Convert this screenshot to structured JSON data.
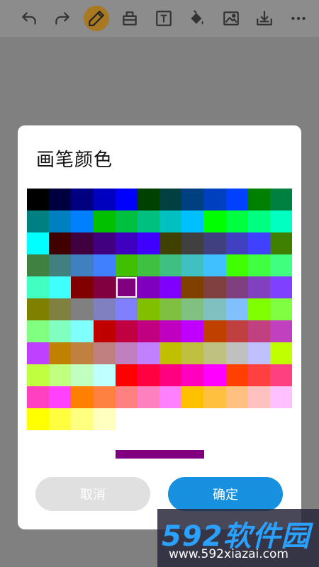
{
  "toolbar": {
    "tools": [
      {
        "name": "undo-icon",
        "active": false
      },
      {
        "name": "redo-icon",
        "active": false
      },
      {
        "name": "pen-icon",
        "active": true
      },
      {
        "name": "eraser-icon",
        "active": false
      },
      {
        "name": "text-icon",
        "active": false
      },
      {
        "name": "fill-bucket-icon",
        "active": false
      },
      {
        "name": "image-icon",
        "active": false
      },
      {
        "name": "save-icon",
        "active": false
      },
      {
        "name": "more-icon",
        "active": false
      }
    ],
    "active_color": "#a87920"
  },
  "dialog": {
    "title": "画笔颜色",
    "selected_index": 52,
    "selected_color": "#800080",
    "cancel_label": "取消",
    "ok_label": "确定",
    "ok_color": "#1790e0",
    "cancel_color": "#e0e0e0"
  },
  "palette_colors": [
    "#000000",
    "#000040",
    "#000080",
    "#0000c0",
    "#0000ff",
    "#004000",
    "#004040",
    "#004080",
    "#0040c0",
    "#0040ff",
    "#008000",
    "#008040",
    "#008080",
    "#0080c0",
    "#0080ff",
    "#00c000",
    "#00c040",
    "#00c080",
    "#00c0c0",
    "#00c0ff",
    "#00ff00",
    "#00ff40",
    "#00ff80",
    "#00ffc0",
    "#00ffff",
    "#400000",
    "#400040",
    "#400080",
    "#4000c0",
    "#4000ff",
    "#404000",
    "#404040",
    "#404080",
    "#4040c0",
    "#4040ff",
    "#408000",
    "#408040",
    "#408080",
    "#4080c0",
    "#4080ff",
    "#40c000",
    "#40c040",
    "#40c080",
    "#40c0c0",
    "#40c0ff",
    "#40ff00",
    "#40ff40",
    "#40ff80",
    "#40ffc0",
    "#40ffff",
    "#800000",
    "#800040",
    "#800080",
    "#8000c0",
    "#8000ff",
    "#804000",
    "#804040",
    "#804080",
    "#8040c0",
    "#8040ff",
    "#808000",
    "#808040",
    "#808080",
    "#8080c0",
    "#8080ff",
    "#80c000",
    "#80c040",
    "#80c080",
    "#80c0c0",
    "#80c0ff",
    "#80ff00",
    "#80ff40",
    "#80ff80",
    "#80ffc0",
    "#80ffff",
    "#c00000",
    "#c00040",
    "#c00080",
    "#c000c0",
    "#c000ff",
    "#c04000",
    "#c04040",
    "#c04080",
    "#c040c0",
    "#c040ff",
    "#c08000",
    "#c08040",
    "#c08080",
    "#c080c0",
    "#c080ff",
    "#c0c000",
    "#c0c040",
    "#c0c080",
    "#c0c0c0",
    "#c0c0ff",
    "#c0ff00",
    "#c0ff40",
    "#c0ff80",
    "#c0ffc0",
    "#c0ffff",
    "#ff0000",
    "#ff0040",
    "#ff0080",
    "#ff00c0",
    "#ff00ff",
    "#ff4000",
    "#ff4040",
    "#ff4080",
    "#ff40c0",
    "#ff40ff",
    "#ff8000",
    "#ff8040",
    "#ff8080",
    "#ff80c0",
    "#ff80ff",
    "#ffc000",
    "#ffc040",
    "#ffc080",
    "#ffc0c0",
    "#ffc0ff",
    "#ffff00",
    "#ffff40",
    "#ffff80",
    "#ffffc0"
  ],
  "watermark": {
    "main": "592软件园",
    "sub": "www.592xiazai.com"
  }
}
